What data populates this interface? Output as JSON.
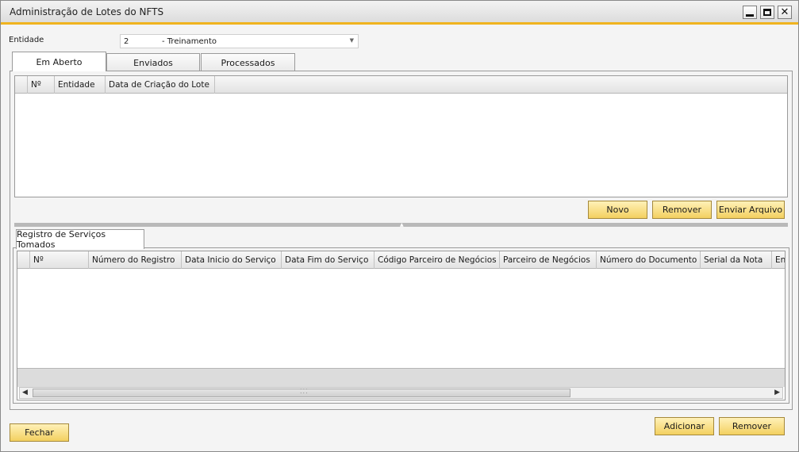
{
  "window": {
    "title": "Administração de Lotes do NFTS",
    "min_icon": "minimize-icon",
    "max_icon": "maximize-icon",
    "close_icon": "close-icon",
    "close_glyph": "✕"
  },
  "entity": {
    "label": "Entidade",
    "code": "2",
    "name": "- Treinamento"
  },
  "top_tabs": [
    "Em Aberto",
    "Enviados",
    "Processados"
  ],
  "top_grid": {
    "columns": [
      "Nº",
      "Entidade",
      "Data de Criação do Lote"
    ]
  },
  "top_buttons": {
    "new": "Novo",
    "remove": "Remover",
    "send": "Enviar Arquivo"
  },
  "bottom_tab": "Registro de Serviços Tomados",
  "bottom_grid": {
    "columns": [
      "Nº",
      "Número do Registro",
      "Data Inicio do Serviço",
      "Data Fim do Serviço",
      "Código Parceiro de Negócios",
      "Parceiro de Negócios",
      "Número do Documento",
      "Serial da Nota",
      "En"
    ]
  },
  "footer": {
    "close": "Fechar",
    "add": "Adicionar",
    "remove": "Remover"
  },
  "colors": {
    "accent": "#f0b31f",
    "button": "#f3d060"
  }
}
